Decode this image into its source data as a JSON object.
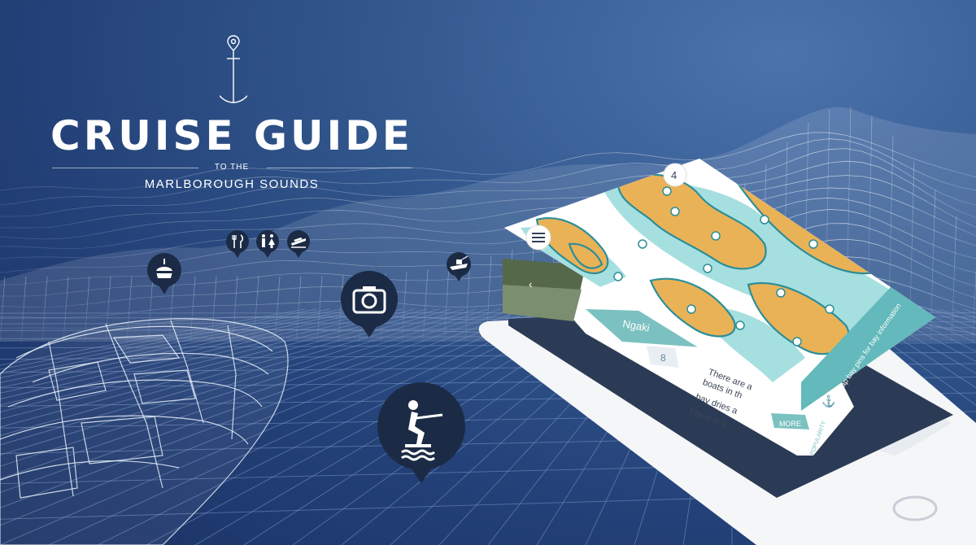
{
  "logo": {
    "title": "CRUISE GUIDE",
    "subtitle_small": "TO THE",
    "subtitle_main": "MARLBOROUGH SOUNDS"
  },
  "app_screen": {
    "map_hint": "Tap bay pins for bay information",
    "map_count_badge": "4",
    "bay_name": "Ngaki",
    "bay_text_lines": [
      "There are a",
      "boats in th",
      "bay dries a",
      "There is s"
    ],
    "more_button": "MORE",
    "popularity_label": "POPULARITY",
    "bay_number": "8"
  },
  "icons": {
    "pins": [
      "buoy-icon",
      "camera-icon",
      "water-ski-icon",
      "restaurant-icon",
      "toilets-icon",
      "boat-ramp-icon",
      "fishing-boat-icon"
    ],
    "anchor": "anchor-icon",
    "menu": "hamburger-menu-icon",
    "back": "back-arrow-icon"
  },
  "colors": {
    "background": "#2a4b82",
    "pin": "#1c2b45",
    "map_land": "#e9b257",
    "map_water": "#a6dfe0",
    "teal_bar": "#63b9bb",
    "phone_dark_panel": "#2c3b55"
  }
}
